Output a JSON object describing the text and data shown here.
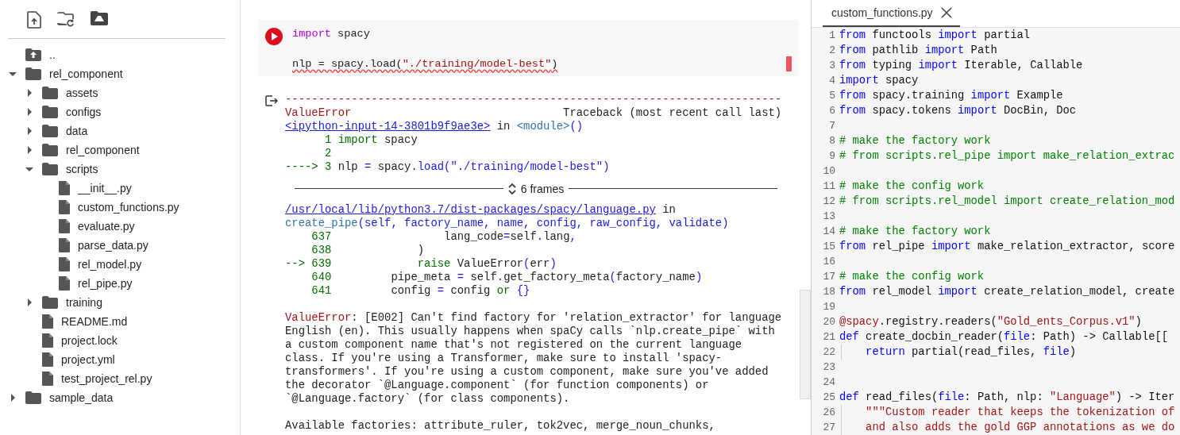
{
  "files": {
    "items": [
      {
        "name": "..",
        "kind": "up"
      },
      {
        "name": "rel_component",
        "kind": "folder",
        "expanded": true,
        "children": [
          {
            "name": "assets",
            "kind": "folder",
            "expanded": false
          },
          {
            "name": "configs",
            "kind": "folder",
            "expanded": false
          },
          {
            "name": "data",
            "kind": "folder",
            "expanded": false
          },
          {
            "name": "rel_component",
            "kind": "folder",
            "expanded": false
          },
          {
            "name": "scripts",
            "kind": "folder",
            "expanded": true,
            "children": [
              {
                "name": "__init__.py",
                "kind": "file"
              },
              {
                "name": "custom_functions.py",
                "kind": "file"
              },
              {
                "name": "evaluate.py",
                "kind": "file"
              },
              {
                "name": "parse_data.py",
                "kind": "file"
              },
              {
                "name": "rel_model.py",
                "kind": "file"
              },
              {
                "name": "rel_pipe.py",
                "kind": "file"
              }
            ]
          },
          {
            "name": "training",
            "kind": "folder",
            "expanded": false
          },
          {
            "name": "README.md",
            "kind": "file"
          },
          {
            "name": "project.lock",
            "kind": "file"
          },
          {
            "name": "project.yml",
            "kind": "file"
          },
          {
            "name": "test_project_rel.py",
            "kind": "file"
          }
        ]
      },
      {
        "name": "sample_data",
        "kind": "folder",
        "expanded": false
      }
    ]
  },
  "cell": {
    "code": [
      {
        "blank_before": false,
        "squiggle": false,
        "tokens": [
          {
            "kind": "kw",
            "text": "import"
          },
          {
            "kind": "p",
            "text": " spacy"
          }
        ]
      },
      {
        "blank_before": true,
        "squiggle": true,
        "tokens": [
          {
            "kind": "p",
            "text": "nlp = spacy.load("
          },
          {
            "kind": "str",
            "text": "\"./training/model-best\""
          },
          {
            "kind": "p",
            "text": ")"
          }
        ]
      }
    ],
    "output_before": [
      {
        "tokens": [
          {
            "kind": "err",
            "text": "---------------------------------------------------------------------------"
          }
        ]
      },
      {
        "tokens": [
          {
            "kind": "err",
            "text": "ValueError"
          },
          {
            "kind": "p",
            "text": "                                Traceback (most recent call last)"
          }
        ]
      },
      {
        "tokens": [
          {
            "kind": "link",
            "text": "<ipython-input-14-3801b9f9ae3e>"
          },
          {
            "kind": "p",
            "text": " in "
          },
          {
            "kind": "fn",
            "text": "<module>"
          },
          {
            "kind": "bl",
            "text": "()"
          }
        ]
      },
      {
        "tokens": [
          {
            "kind": "gr",
            "text": "      1 import"
          },
          {
            "kind": "p",
            "text": " spacy"
          }
        ]
      },
      {
        "tokens": [
          {
            "kind": "gr",
            "text": "      2"
          }
        ]
      },
      {
        "tokens": [
          {
            "kind": "gr",
            "text": "----> 3 "
          },
          {
            "kind": "p",
            "text": "nlp "
          },
          {
            "kind": "bl",
            "text": "="
          },
          {
            "kind": "p",
            "text": " spacy"
          },
          {
            "kind": "bl",
            "text": ".load(\"./training/model-best\")"
          }
        ]
      }
    ],
    "frames": "6 frames",
    "output_after": [
      {
        "blank_before": false,
        "tokens": [
          {
            "kind": "link",
            "text": "/usr/local/lib/python3.7/dist-packages/spacy/language.py"
          },
          {
            "kind": "p",
            "text": " in"
          }
        ]
      },
      {
        "blank_before": false,
        "tokens": [
          {
            "kind": "fn",
            "text": "create_pipe"
          },
          {
            "kind": "bl",
            "text": "(self, factory_name, name, config, raw_config, validate)"
          }
        ]
      },
      {
        "blank_before": false,
        "tokens": [
          {
            "kind": "gr",
            "text": "    637"
          },
          {
            "kind": "p",
            "text": "                 lang_code"
          },
          {
            "kind": "bl",
            "text": "="
          },
          {
            "kind": "p",
            "text": "self"
          },
          {
            "kind": "bl",
            "text": "."
          },
          {
            "kind": "p",
            "text": "lang"
          },
          {
            "kind": "bl",
            "text": ","
          }
        ]
      },
      {
        "blank_before": false,
        "tokens": [
          {
            "kind": "gr",
            "text": "    638"
          },
          {
            "kind": "p",
            "text": "             )"
          }
        ]
      },
      {
        "blank_before": false,
        "tokens": [
          {
            "kind": "gr",
            "text": "--> 639             raise"
          },
          {
            "kind": "p",
            "text": " ValueError"
          },
          {
            "kind": "bl",
            "text": "("
          },
          {
            "kind": "p",
            "text": "err"
          },
          {
            "kind": "bl",
            "text": ")"
          }
        ]
      },
      {
        "blank_before": false,
        "tokens": [
          {
            "kind": "gr",
            "text": "    640"
          },
          {
            "kind": "p",
            "text": "         pipe_meta "
          },
          {
            "kind": "bl",
            "text": "="
          },
          {
            "kind": "p",
            "text": " self"
          },
          {
            "kind": "bl",
            "text": "."
          },
          {
            "kind": "p",
            "text": "get_factory_meta"
          },
          {
            "kind": "bl",
            "text": "("
          },
          {
            "kind": "p",
            "text": "factory_name"
          },
          {
            "kind": "bl",
            "text": ")"
          }
        ]
      },
      {
        "blank_before": false,
        "tokens": [
          {
            "kind": "gr",
            "text": "    641"
          },
          {
            "kind": "p",
            "text": "         config "
          },
          {
            "kind": "bl",
            "text": "="
          },
          {
            "kind": "p",
            "text": " config "
          },
          {
            "kind": "gr",
            "text": "or "
          },
          {
            "kind": "bl",
            "text": "{}"
          }
        ]
      },
      {
        "blank_before": true,
        "tokens": [
          {
            "kind": "err",
            "text": "ValueError"
          },
          {
            "kind": "p",
            "text": ": [E002] Can't find factory for 'relation_extractor' for language"
          }
        ]
      },
      {
        "blank_before": false,
        "tokens": [
          {
            "kind": "p",
            "text": "English (en). This usually happens when spaCy calls `nlp.create_pipe` with"
          }
        ]
      },
      {
        "blank_before": false,
        "tokens": [
          {
            "kind": "p",
            "text": "a custom component name that's not registered on the current language"
          }
        ]
      },
      {
        "blank_before": false,
        "tokens": [
          {
            "kind": "p",
            "text": "class. If you're using a Transformer, make sure to install 'spacy-"
          }
        ]
      },
      {
        "blank_before": false,
        "tokens": [
          {
            "kind": "p",
            "text": "transformers'. If you're using a custom component, make sure you've added"
          }
        ]
      },
      {
        "blank_before": false,
        "tokens": [
          {
            "kind": "p",
            "text": "the decorator `@Language.component` (for function components) or"
          }
        ]
      },
      {
        "blank_before": false,
        "tokens": [
          {
            "kind": "p",
            "text": "`@Language.factory` (for class components)."
          }
        ]
      },
      {
        "blank_before": true,
        "tokens": [
          {
            "kind": "p",
            "text": "Available factories: attribute_ruler, tok2vec, merge_noun_chunks,"
          }
        ]
      }
    ]
  },
  "editor": {
    "tabs": [
      {
        "label": "custom_functions.py",
        "selected": true
      }
    ],
    "lines": [
      {
        "n": "1",
        "tokens": [
          {
            "kind": "kw",
            "text": "from"
          },
          {
            "kind": "p",
            "text": " functools "
          },
          {
            "kind": "kw",
            "text": "import"
          },
          {
            "kind": "p",
            "text": " partial"
          }
        ]
      },
      {
        "n": "2",
        "tokens": [
          {
            "kind": "kw",
            "text": "from"
          },
          {
            "kind": "p",
            "text": " pathlib "
          },
          {
            "kind": "kw",
            "text": "import"
          },
          {
            "kind": "p",
            "text": " Path"
          }
        ]
      },
      {
        "n": "3",
        "tokens": [
          {
            "kind": "kw",
            "text": "from"
          },
          {
            "kind": "p",
            "text": " typing "
          },
          {
            "kind": "kw",
            "text": "import"
          },
          {
            "kind": "p",
            "text": " Iterable, Callable"
          }
        ]
      },
      {
        "n": "4",
        "tokens": [
          {
            "kind": "kw",
            "text": "import"
          },
          {
            "kind": "p",
            "text": " spacy"
          }
        ]
      },
      {
        "n": "5",
        "tokens": [
          {
            "kind": "kw",
            "text": "from"
          },
          {
            "kind": "p",
            "text": " spacy.training "
          },
          {
            "kind": "kw",
            "text": "import"
          },
          {
            "kind": "p",
            "text": " Example"
          }
        ]
      },
      {
        "n": "6",
        "tokens": [
          {
            "kind": "kw",
            "text": "from"
          },
          {
            "kind": "p",
            "text": " spacy.tokens "
          },
          {
            "kind": "kw",
            "text": "import"
          },
          {
            "kind": "p",
            "text": " DocBin, Doc"
          }
        ]
      },
      {
        "n": "7"
      },
      {
        "n": "8",
        "tokens": [
          {
            "kind": "cm",
            "text": "# make the factory work"
          }
        ]
      },
      {
        "n": "9",
        "tokens": [
          {
            "kind": "cm",
            "text": "# from scripts.rel_pipe import make_relation_extrac"
          }
        ]
      },
      {
        "n": "10"
      },
      {
        "n": "11",
        "tokens": [
          {
            "kind": "cm",
            "text": "# make the config work"
          }
        ]
      },
      {
        "n": "12",
        "tokens": [
          {
            "kind": "cm",
            "text": "# from scripts.rel_model import create_relation_mod"
          }
        ]
      },
      {
        "n": "13"
      },
      {
        "n": "14",
        "tokens": [
          {
            "kind": "cm",
            "text": "# make the factory work"
          }
        ]
      },
      {
        "n": "15",
        "tokens": [
          {
            "kind": "kw",
            "text": "from"
          },
          {
            "kind": "p",
            "text": " rel_pipe "
          },
          {
            "kind": "kw",
            "text": "import"
          },
          {
            "kind": "p",
            "text": " make_relation_extractor, score"
          }
        ]
      },
      {
        "n": "16"
      },
      {
        "n": "17",
        "tokens": [
          {
            "kind": "cm",
            "text": "# make the config work"
          }
        ]
      },
      {
        "n": "18",
        "tokens": [
          {
            "kind": "kw",
            "text": "from"
          },
          {
            "kind": "p",
            "text": " rel_model "
          },
          {
            "kind": "kw",
            "text": "import"
          },
          {
            "kind": "p",
            "text": " create_relation_model, create"
          }
        ]
      },
      {
        "n": "19"
      },
      {
        "n": "20",
        "tokens": [
          {
            "kind": "str",
            "text": "@spacy"
          },
          {
            "kind": "p",
            "text": ".registry.readers("
          },
          {
            "kind": "str",
            "text": "\"Gold_ents_Corpus.v1\""
          },
          {
            "kind": "p",
            "text": ")"
          }
        ]
      },
      {
        "n": "21",
        "tokens": [
          {
            "kind": "kw",
            "text": "def"
          },
          {
            "kind": "p",
            "text": " create_docbin_reader("
          },
          {
            "kind": "kw",
            "text": "file"
          },
          {
            "kind": "p",
            "text": ": Path) -> Callable[["
          }
        ]
      },
      {
        "n": "22",
        "indent_guide": true,
        "tokens": [
          {
            "kind": "kw",
            "text": "    return"
          },
          {
            "kind": "p",
            "text": " partial(read_files, "
          },
          {
            "kind": "kw",
            "text": "file"
          },
          {
            "kind": "p",
            "text": ")"
          }
        ]
      },
      {
        "n": "23"
      },
      {
        "n": "24"
      },
      {
        "n": "25",
        "tokens": [
          {
            "kind": "kw",
            "text": "def"
          },
          {
            "kind": "p",
            "text": " read_files("
          },
          {
            "kind": "kw",
            "text": "file"
          },
          {
            "kind": "p",
            "text": ": Path, nlp: "
          },
          {
            "kind": "str",
            "text": "\"Language\""
          },
          {
            "kind": "p",
            "text": ") -> Iter"
          }
        ]
      },
      {
        "n": "26",
        "indent_guide": true,
        "tokens": [
          {
            "kind": "str",
            "text": "    \"\"\"Custom reader that keeps the tokenization of"
          }
        ]
      },
      {
        "n": "27",
        "indent_guide": true,
        "tokens": [
          {
            "kind": "str",
            "text": "    and also adds the gold GGP annotations as we do"
          }
        ]
      }
    ]
  }
}
